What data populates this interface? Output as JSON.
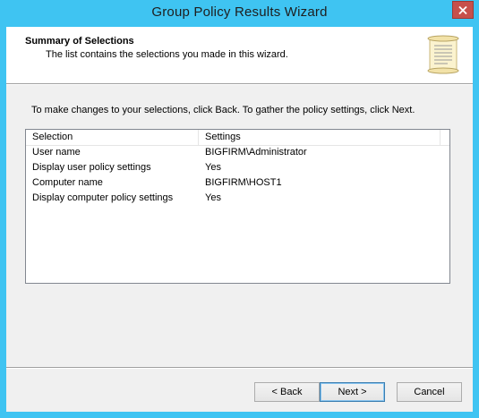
{
  "window": {
    "title": "Group Policy Results Wizard"
  },
  "header": {
    "title": "Summary of Selections",
    "subtitle": "The list contains the selections you made in this wizard.",
    "icon": "scroll-icon"
  },
  "instructions": "To make changes to your selections, click Back. To gather the policy settings, click Next.",
  "list": {
    "columns": [
      "Selection",
      "Settings"
    ],
    "rows": [
      [
        "User name",
        "BIGFIRM\\Administrator"
      ],
      [
        "Display user policy settings",
        "Yes"
      ],
      [
        "Computer name",
        "BIGFIRM\\HOST1"
      ],
      [
        "Display computer policy settings",
        "Yes"
      ]
    ]
  },
  "buttons": {
    "back": "< Back",
    "next": "Next >",
    "cancel": "Cancel"
  },
  "colors": {
    "frame": "#3fc4f2",
    "close": "#c7504b",
    "dialog": "#f0f0f0"
  }
}
